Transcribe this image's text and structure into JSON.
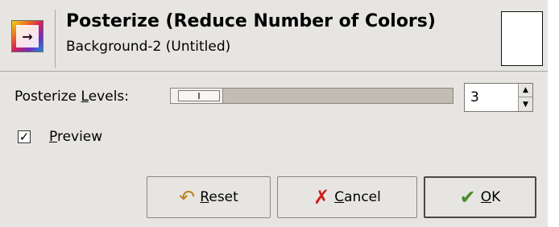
{
  "header": {
    "title": "Posterize (Reduce Number of Colors)",
    "subtitle": "Background-2 (Untitled)",
    "icon": "posterize-icon"
  },
  "levels": {
    "label_prefix": "Posterize ",
    "label_mnemonic": "L",
    "label_suffix": "evels:",
    "value": "3",
    "slider_fraction": 0.009
  },
  "preview": {
    "checked": true,
    "check_glyph": "✓",
    "label_mnemonic": "P",
    "label_rest": "review"
  },
  "buttons": {
    "reset": {
      "mnemonic": "R",
      "rest": "eset",
      "icon": "reset-icon"
    },
    "cancel": {
      "mnemonic": "C",
      "rest": "ancel",
      "icon": "cancel-icon"
    },
    "ok": {
      "mnemonic": "O",
      "rest": "K",
      "icon": "ok-icon"
    }
  }
}
